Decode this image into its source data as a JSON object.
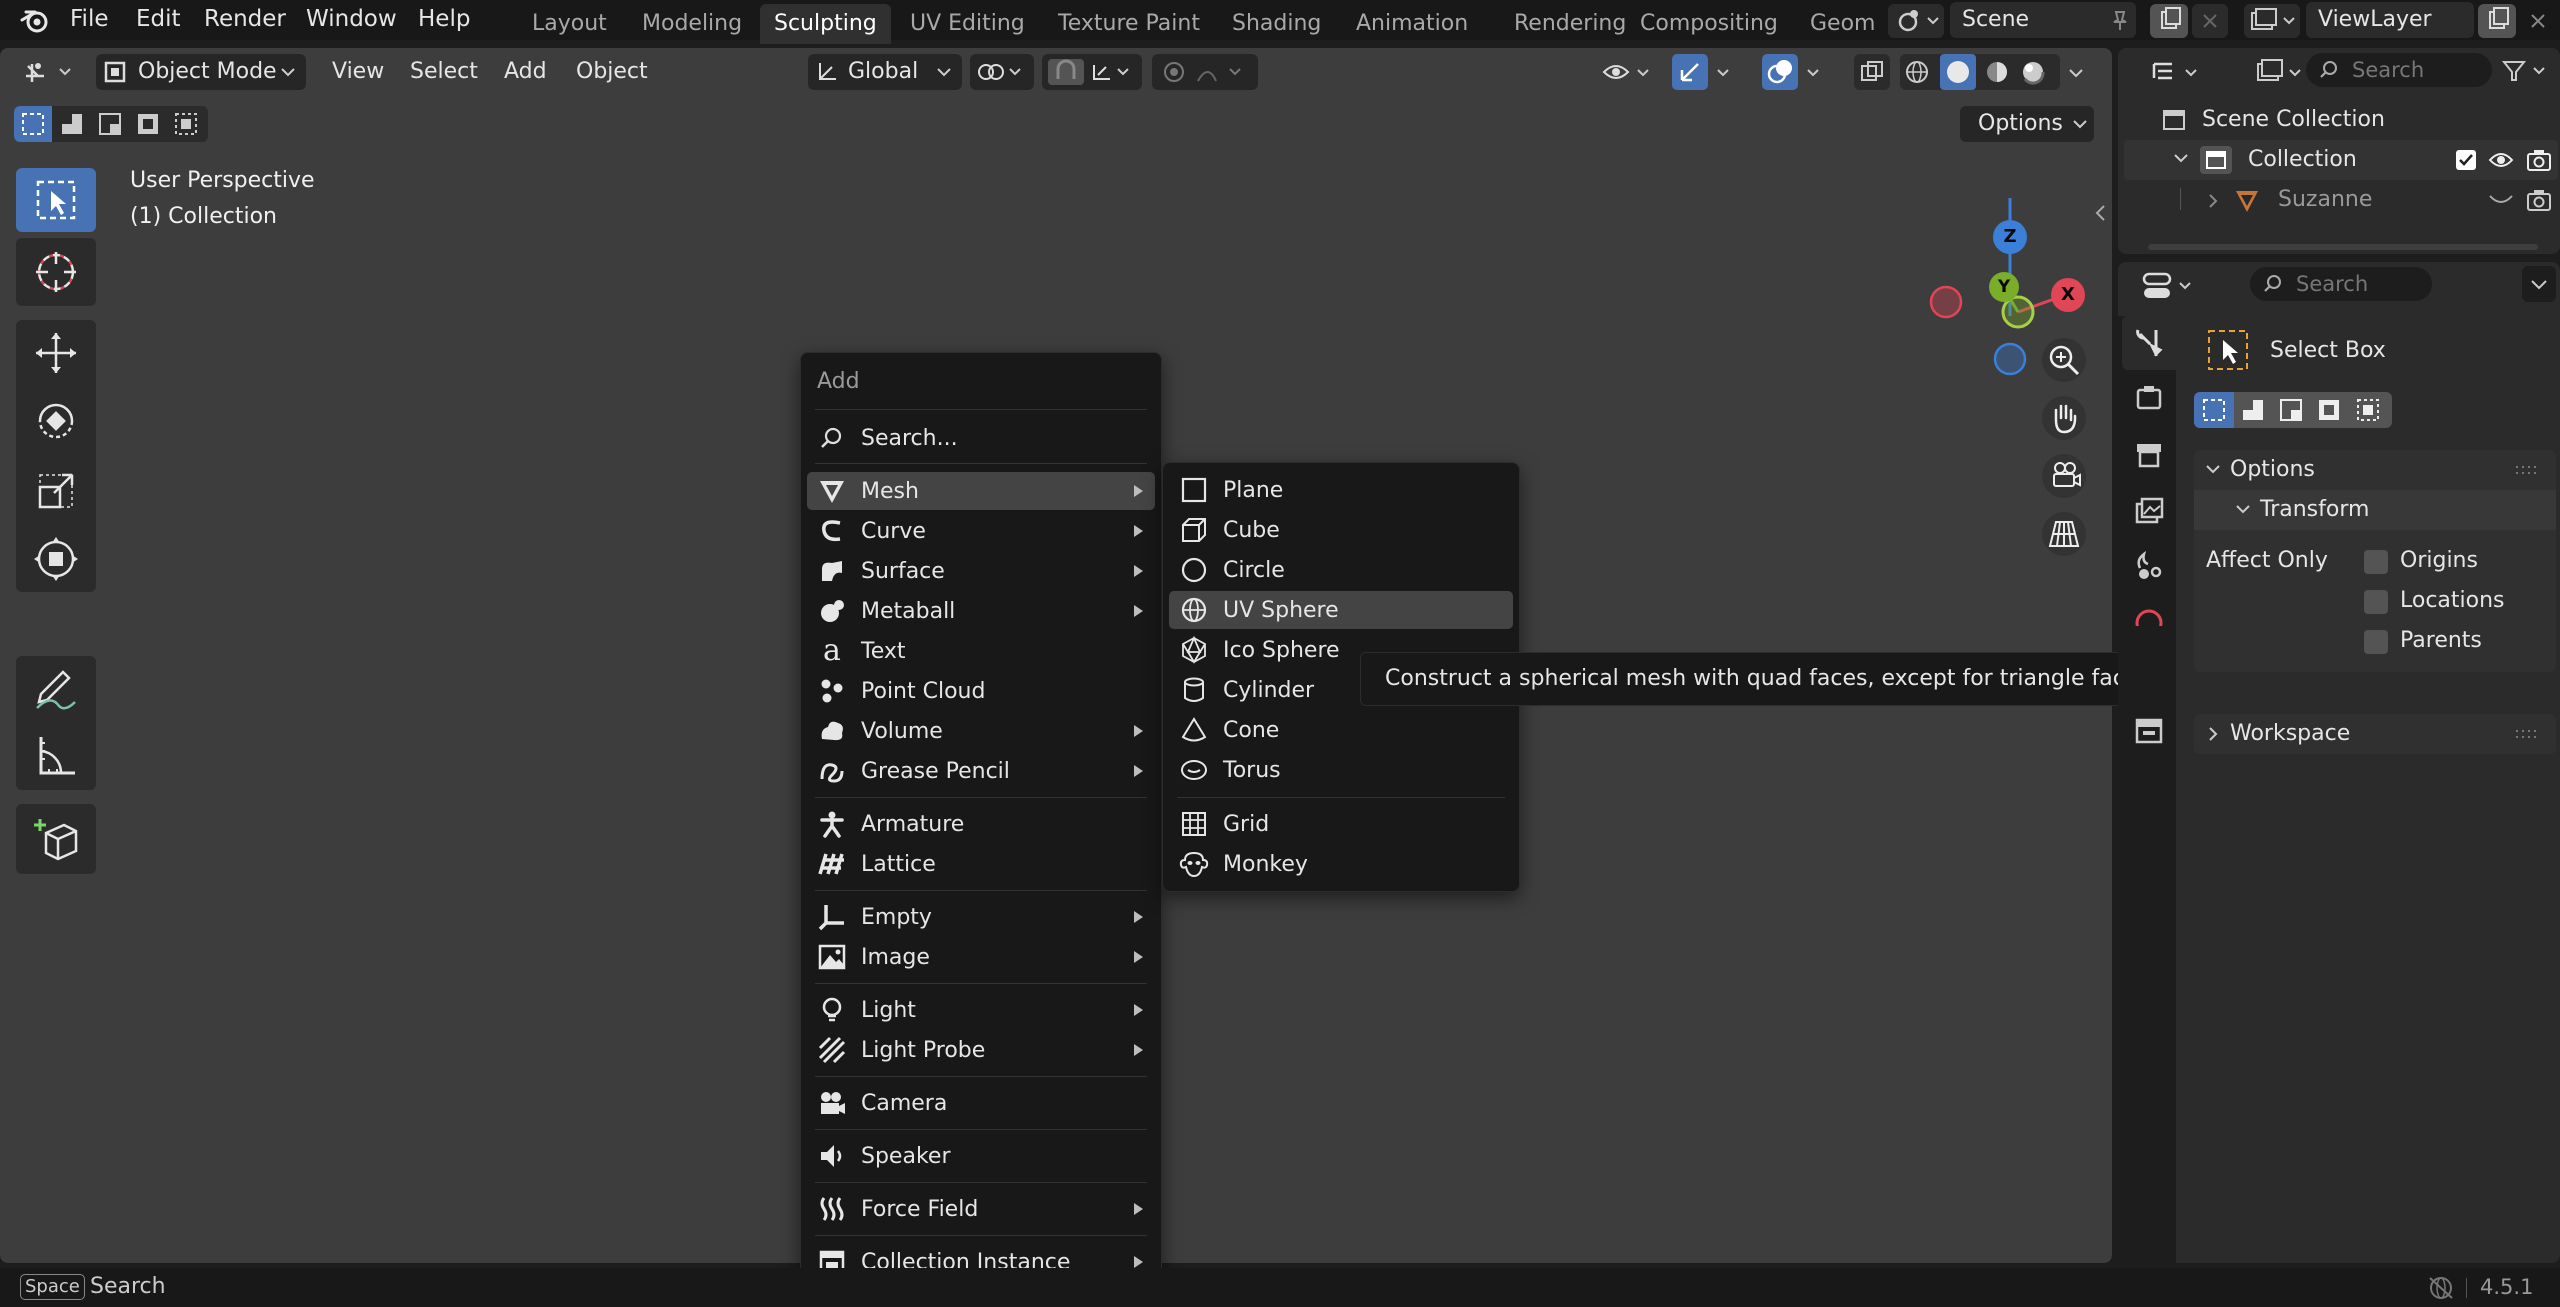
{
  "menubar": {
    "file": "File",
    "edit": "Edit",
    "render": "Render",
    "window": "Window",
    "help": "Help"
  },
  "workspaces": [
    "Layout",
    "Modeling",
    "Sculpting",
    "UV Editing",
    "Texture Paint",
    "Shading",
    "Animation",
    "Rendering",
    "Compositing",
    "Geom"
  ],
  "active_workspace": "Sculpting",
  "scene": {
    "name": "Scene"
  },
  "view_layer": {
    "name": "ViewLayer"
  },
  "viewport_header": {
    "mode": "Object Mode",
    "view": "View",
    "select": "Select",
    "add": "Add",
    "object": "Object",
    "orientation": "Global",
    "options": "Options"
  },
  "viewport_overlay": {
    "perspective": "User Perspective",
    "collection": "(1) Collection"
  },
  "gizmo": {
    "z": "Z",
    "y": "Y",
    "x": "X"
  },
  "add_menu": {
    "title": "Add",
    "search": "Search...",
    "items": [
      {
        "label": "Mesh",
        "icon": "mesh-icon",
        "submenu": true
      },
      {
        "label": "Curve",
        "icon": "curve-icon",
        "submenu": true
      },
      {
        "label": "Surface",
        "icon": "surface-icon",
        "submenu": true
      },
      {
        "label": "Metaball",
        "icon": "metaball-icon",
        "submenu": true
      },
      {
        "label": "Text",
        "icon": "text-icon",
        "submenu": false
      },
      {
        "label": "Point Cloud",
        "icon": "point-cloud-icon",
        "submenu": false
      },
      {
        "label": "Volume",
        "icon": "volume-icon",
        "submenu": true
      },
      {
        "label": "Grease Pencil",
        "icon": "grease-pencil-icon",
        "submenu": true
      },
      {
        "label": "Armature",
        "icon": "armature-icon",
        "submenu": false
      },
      {
        "label": "Lattice",
        "icon": "lattice-icon",
        "submenu": false
      },
      {
        "label": "Empty",
        "icon": "empty-icon",
        "submenu": true
      },
      {
        "label": "Image",
        "icon": "image-icon",
        "submenu": true
      },
      {
        "label": "Light",
        "icon": "light-icon",
        "submenu": true
      },
      {
        "label": "Light Probe",
        "icon": "light-probe-icon",
        "submenu": true
      },
      {
        "label": "Camera",
        "icon": "camera-icon",
        "submenu": false
      },
      {
        "label": "Speaker",
        "icon": "speaker-icon",
        "submenu": false
      },
      {
        "label": "Force Field",
        "icon": "force-field-icon",
        "submenu": true
      },
      {
        "label": "Collection Instance",
        "icon": "collection-instance-icon",
        "submenu": true
      }
    ]
  },
  "mesh_menu": {
    "items": [
      {
        "label": "Plane",
        "icon": "plane-icon"
      },
      {
        "label": "Cube",
        "icon": "cube-icon"
      },
      {
        "label": "Circle",
        "icon": "circle-icon"
      },
      {
        "label": "UV Sphere",
        "icon": "uv-sphere-icon"
      },
      {
        "label": "Ico Sphere",
        "icon": "ico-sphere-icon"
      },
      {
        "label": "Cylinder",
        "icon": "cylinder-icon"
      },
      {
        "label": "Cone",
        "icon": "cone-icon"
      },
      {
        "label": "Torus",
        "icon": "torus-icon"
      },
      {
        "label": "Grid",
        "icon": "grid-icon"
      },
      {
        "label": "Monkey",
        "icon": "monkey-icon"
      }
    ],
    "highlighted": "UV Sphere"
  },
  "tooltip": "Construct a spherical mesh with quad faces, except for triangle faces at the top and bottom.",
  "outliner": {
    "search_placeholder": "Search",
    "scene_collection": "Scene Collection",
    "collection": "Collection",
    "object": "Suzanne"
  },
  "properties": {
    "search_placeholder": "Search",
    "tool_name": "Select Box",
    "options": "Options",
    "transform": "Transform",
    "affect_only": "Affect Only",
    "origins": "Origins",
    "locations": "Locations",
    "parents": "Parents",
    "workspace": "Workspace"
  },
  "statusbar": {
    "key": "Space",
    "action": "Search",
    "version": "4.5.1"
  },
  "colors": {
    "accent": "#4772b3",
    "x_axis": "#e04656",
    "y_axis": "#7aad2a",
    "z_axis": "#3b7fd9",
    "object_orange": "#c4753a"
  }
}
